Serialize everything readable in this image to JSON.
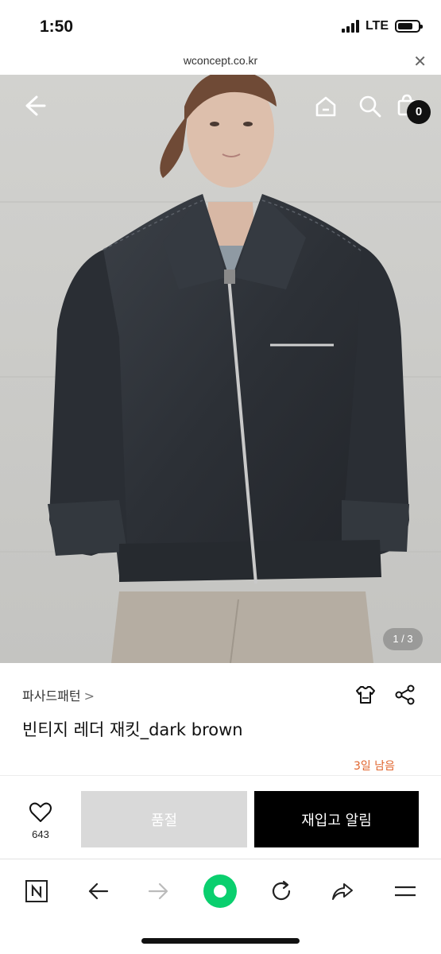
{
  "status_bar": {
    "time": "1:50",
    "network": "LTE",
    "battery_level": 0.75
  },
  "url_bar": {
    "url": "wconcept.co.kr",
    "close_icon": "close-icon"
  },
  "hero": {
    "icons": [
      "back-arrow-icon",
      "home-icon",
      "search-icon",
      "cart-icon"
    ],
    "cart_count": "0",
    "image_counter": "1 / 3"
  },
  "product": {
    "brand": "파사드패턴",
    "brand_chevron": ">",
    "title": "빈티지 레더 재킷_dark brown",
    "remaining": "3일 남음",
    "icons": [
      "size-guide-tshirt-icon",
      "share-icon"
    ]
  },
  "actions": {
    "like_count": "643",
    "sold_out_label": "품절",
    "restock_label": "재입고 알림"
  },
  "browser_bar": {
    "icons": [
      "naver-n-icon",
      "back-icon",
      "forward-icon",
      "green-dot-icon",
      "reload-icon",
      "share-icon",
      "menu-icon"
    ]
  },
  "colors": {
    "accent_remaining": "#e0652e",
    "restock_button": "#000000",
    "sold_out_button": "#d9d9d9",
    "green_dot": "#0acf6e"
  }
}
